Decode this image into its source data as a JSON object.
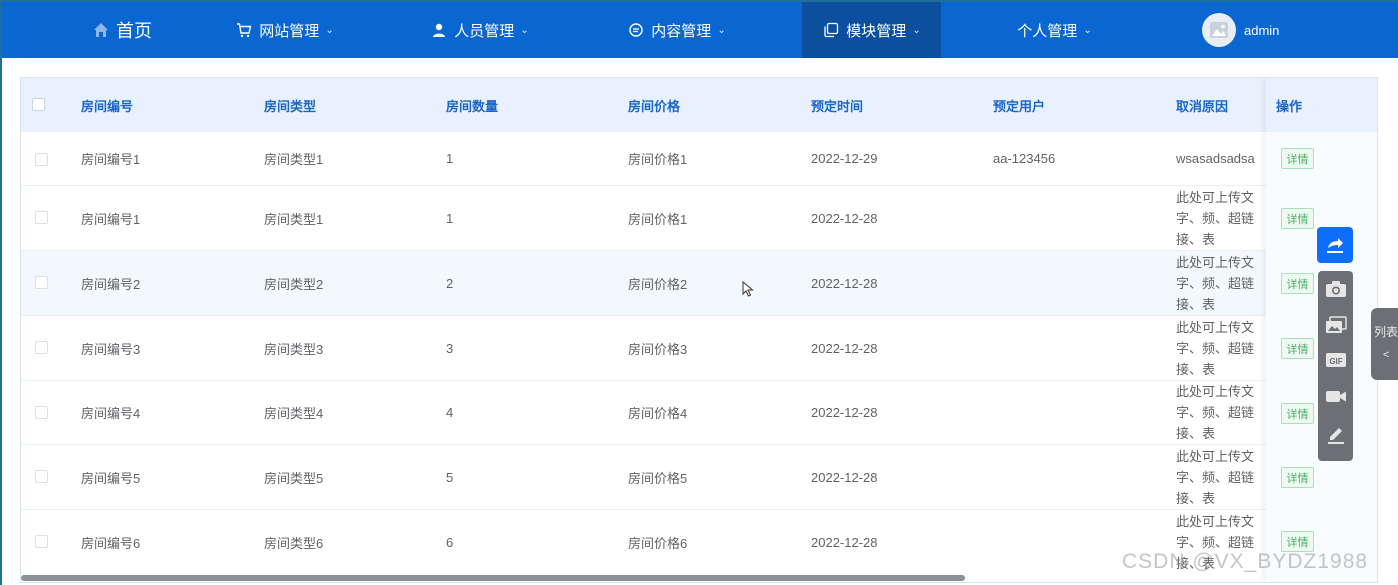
{
  "nav": {
    "home": "首页",
    "items": [
      {
        "label": "网站管理"
      },
      {
        "label": "人员管理"
      },
      {
        "label": "内容管理"
      },
      {
        "label": "模块管理"
      },
      {
        "label": "个人管理"
      }
    ],
    "user": "admin",
    "active_index": 3
  },
  "table": {
    "headers": [
      "房间编号",
      "房间类型",
      "房间数量",
      "房间价格",
      "预定时间",
      "预定用户",
      "取消原因"
    ],
    "action_header": "操作",
    "action_label": "详情",
    "rows": [
      {
        "no": "房间编号1",
        "type": "房间类型1",
        "count": "1",
        "price": "房间价格1",
        "time": "2022-12-29",
        "user": "aa-123456",
        "reason": "wsasadsadsa"
      },
      {
        "no": "房间编号1",
        "type": "房间类型1",
        "count": "1",
        "price": "房间价格1",
        "time": "2022-12-28",
        "user": "",
        "reason": "此处可上传文字、频、超链接、表"
      },
      {
        "no": "房间编号2",
        "type": "房间类型2",
        "count": "2",
        "price": "房间价格2",
        "time": "2022-12-28",
        "user": "",
        "reason": "此处可上传文字、频、超链接、表"
      },
      {
        "no": "房间编号3",
        "type": "房间类型3",
        "count": "3",
        "price": "房间价格3",
        "time": "2022-12-28",
        "user": "",
        "reason": "此处可上传文字、频、超链接、表"
      },
      {
        "no": "房间编号4",
        "type": "房间类型4",
        "count": "4",
        "price": "房间价格4",
        "time": "2022-12-28",
        "user": "",
        "reason": "此处可上传文字、频、超链接、表"
      },
      {
        "no": "房间编号5",
        "type": "房间类型5",
        "count": "5",
        "price": "房间价格5",
        "time": "2022-12-28",
        "user": "",
        "reason": "此处可上传文字、频、超链接、表"
      },
      {
        "no": "房间编号6",
        "type": "房间类型6",
        "count": "6",
        "price": "房间价格6",
        "time": "2022-12-28",
        "user": "",
        "reason": "此处可上传文字、频、超链接、表"
      }
    ]
  },
  "side_tab": {
    "label": "列表",
    "arrow": "<"
  },
  "watermark": "CSDN @VX_BYDZ1988",
  "colors": {
    "nav_bg": "#0a66d0",
    "nav_active": "#0b4f9e",
    "header_bg": "#e8f1fd",
    "header_text": "#1a66c9",
    "detail_green": "#4cae65"
  }
}
